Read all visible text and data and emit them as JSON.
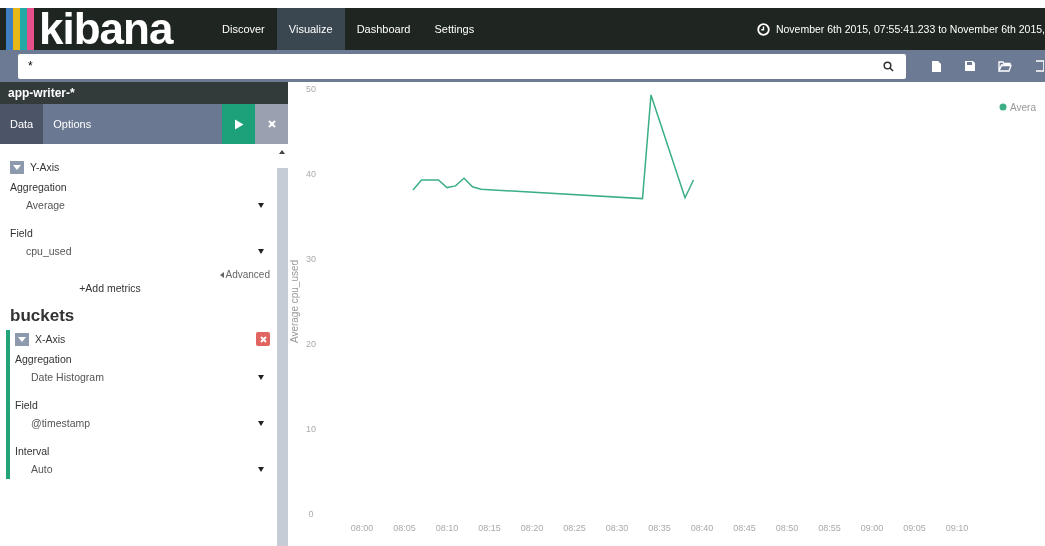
{
  "nav": {
    "logo": "kibana",
    "items": [
      {
        "label": "Discover",
        "selected": false
      },
      {
        "label": "Visualize",
        "selected": true
      },
      {
        "label": "Dashboard",
        "selected": false
      },
      {
        "label": "Settings",
        "selected": false
      }
    ],
    "time_range": "November 6th 2015, 07:55:41.233 to November 6th 2015,"
  },
  "search": {
    "value": "*"
  },
  "sidebar": {
    "index_pattern": "app-writer-*",
    "tabs": [
      {
        "label": "Data",
        "selected": true
      },
      {
        "label": "Options",
        "selected": false
      }
    ],
    "metrics": {
      "agg_title": "Y-Axis",
      "fields": [
        {
          "label": "Aggregation",
          "value": "Average"
        },
        {
          "label": "Field",
          "value": "cpu_used"
        }
      ],
      "advanced_link": "Advanced",
      "add_button": "+Add metrics"
    },
    "buckets": {
      "title": "buckets",
      "agg_title": "X-Axis",
      "fields": [
        {
          "label": "Aggregation",
          "value": "Date Histogram"
        },
        {
          "label": "Field",
          "value": "@timestamp"
        },
        {
          "label": "Interval",
          "value": "Auto"
        }
      ]
    }
  },
  "chart": {
    "chart_data": {
      "type": "line",
      "ylabel": "Average cpu_used",
      "x": [
        486,
        487,
        488,
        489,
        490,
        491,
        492,
        493,
        494,
        513,
        514,
        518,
        519
      ],
      "series": [
        {
          "name": "Avera",
          "color": "#3caf85",
          "values": [
            38.1,
            39.3,
            39.3,
            39.3,
            38.4,
            38.6,
            39.5,
            38.5,
            38.2,
            37.1,
            49.3,
            37.2,
            39.3
          ]
        }
      ],
      "xlim": [
        480,
        550
      ],
      "ylim": [
        0,
        50
      ],
      "yticks": [
        0,
        10,
        20,
        30,
        40,
        50
      ],
      "xticks": [
        {
          "value": 480,
          "label": "08:00"
        },
        {
          "value": 485,
          "label": "08:05"
        },
        {
          "value": 490,
          "label": "08:10"
        },
        {
          "value": 495,
          "label": "08:15"
        },
        {
          "value": 500,
          "label": "08:20"
        },
        {
          "value": 505,
          "label": "08:25"
        },
        {
          "value": 510,
          "label": "08:30"
        },
        {
          "value": 515,
          "label": "08:35"
        },
        {
          "value": 520,
          "label": "08:40"
        },
        {
          "value": 525,
          "label": "08:45"
        },
        {
          "value": 530,
          "label": "08:50"
        },
        {
          "value": 535,
          "label": "08:55"
        },
        {
          "value": 540,
          "label": "09:00"
        },
        {
          "value": 545,
          "label": "09:05"
        },
        {
          "value": 550,
          "label": "09:10"
        }
      ]
    }
  }
}
